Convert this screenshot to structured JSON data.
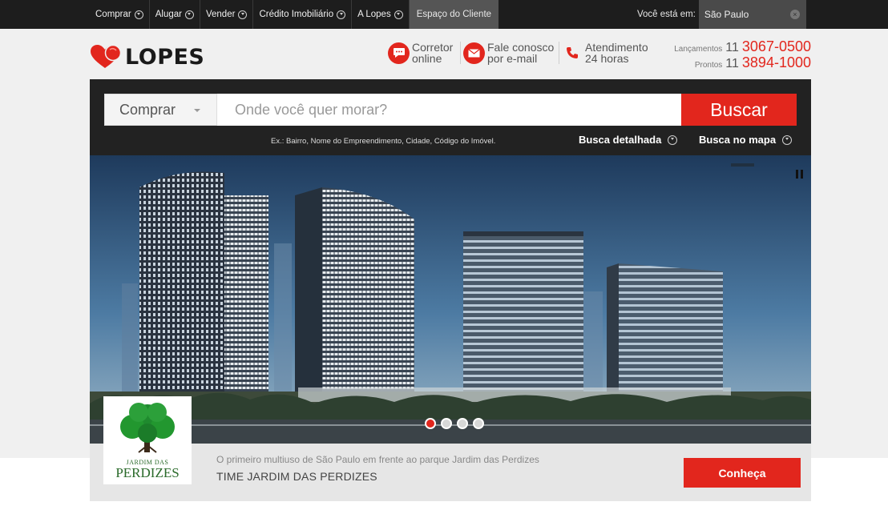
{
  "topnav": {
    "items": [
      {
        "label": "Comprar"
      },
      {
        "label": "Alugar"
      },
      {
        "label": "Vender"
      },
      {
        "label": "Crédito Imobiliário"
      },
      {
        "label": "A Lopes"
      }
    ],
    "client_area": "Espaço do Cliente",
    "location_label": "Você está em:",
    "location_value": "São Paulo"
  },
  "brand": {
    "name": "LOPES"
  },
  "contacts": {
    "chat": {
      "line1": "Corretor",
      "line2": "online"
    },
    "email": {
      "line1": "Fale conosco",
      "line2": "por e-mail"
    },
    "phone": {
      "line1": "Atendimento",
      "line2": "24 horas"
    }
  },
  "phones": {
    "launches_label": "Lançamentos",
    "launches_ddd": "11",
    "launches_number": "3067-0500",
    "ready_label": "Prontos",
    "ready_ddd": "11",
    "ready_number": "3894-1000"
  },
  "search": {
    "type": "Comprar",
    "placeholder": "Onde você quer morar?",
    "button": "Buscar",
    "hint": "Ex.: Bairro, Nome do Empreendimento, Cidade, Código do Imóvel.",
    "detailed": "Busca detalhada",
    "map": "Busca no mapa"
  },
  "hero": {
    "slides": 4,
    "active_slide": 1,
    "badge_line1": "JARDIM DAS",
    "badge_line2": "PERDIZES",
    "description": "O primeiro multiuso de São Paulo em frente ao parque Jardim das Perdizes",
    "title": "TIME JARDIM DAS PERDIZES",
    "cta": "Conheça"
  },
  "colors": {
    "accent": "#e2261d",
    "topbar": "#1d1d1d",
    "panel": "#222222",
    "band": "#f0f0f0"
  },
  "icons": [
    "chevron-down-icon",
    "close-icon",
    "chat-icon",
    "mail-icon",
    "phone-icon",
    "pause-icon",
    "heart-logo-icon",
    "tree-icon"
  ]
}
